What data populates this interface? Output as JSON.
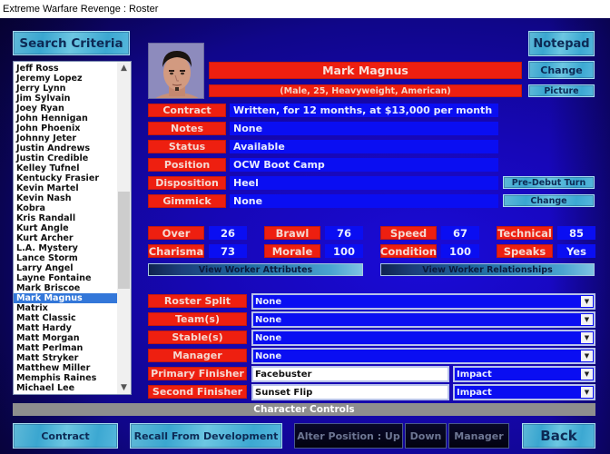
{
  "window": {
    "title": "Extreme Warfare Revenge : Roster"
  },
  "left": {
    "search_label": "Search Criteria",
    "roster": [
      "Jeff Ross",
      "Jeremy Lopez",
      "Jerry Lynn",
      "Jim Sylvain",
      "Joey Ryan",
      "John Hennigan",
      "John Phoenix",
      "Johnny Jeter",
      "Justin Andrews",
      "Justin Credible",
      "Kelley Tufnel",
      "Kentucky Frasier",
      "Kevin Martel",
      "Kevin Nash",
      "Kobra",
      "Kris Randall",
      "Kurt Angle",
      "Kurt Archer",
      "L.A. Mystery",
      "Lance Storm",
      "Larry Angel",
      "Layne Fontaine",
      "Mark Briscoe",
      "Mark Magnus",
      "Matrix",
      "Matt Classic",
      "Matt Hardy",
      "Matt Morgan",
      "Matt Perlman",
      "Matt Stryker",
      "Matthew Miller",
      "Memphis Raines",
      "Michael Lee"
    ],
    "selected": "Mark Magnus",
    "scroll_up_icon": "▲",
    "scroll_down_icon": "▼"
  },
  "worker": {
    "name": "Mark Magnus",
    "details": "(Male, 25, Heavyweight, American)",
    "photo_icon": "worker-portrait"
  },
  "right_buttons": {
    "notepad": "Notepad",
    "change_picture_line1": "Change",
    "change_picture_line2": "Picture",
    "pre_debut_turn": "Pre-Debut Turn",
    "change_gimmick": "Change"
  },
  "info_rows": [
    {
      "label": "Contract",
      "value": "Written, for 12 months, at $13,000 per month"
    },
    {
      "label": "Notes",
      "value": "None"
    },
    {
      "label": "Status",
      "value": "Available"
    },
    {
      "label": "Position",
      "value": "OCW Boot Camp"
    },
    {
      "label": "Disposition",
      "value": "Heel"
    },
    {
      "label": "Gimmick",
      "value": "None"
    }
  ],
  "stats": [
    {
      "label": "Over",
      "value": "26"
    },
    {
      "label": "Brawl",
      "value": "76"
    },
    {
      "label": "Speed",
      "value": "67"
    },
    {
      "label": "Technical",
      "value": "85"
    },
    {
      "label": "Charisma",
      "value": "73"
    },
    {
      "label": "Morale",
      "value": "100"
    },
    {
      "label": "Condition",
      "value": "100"
    },
    {
      "label": "Speaks",
      "value": "Yes"
    }
  ],
  "view_buttons": {
    "attributes": "View Worker Attributes",
    "relationships": "View Worker Relationships"
  },
  "assignments": [
    {
      "label": "Roster Split",
      "value": "None"
    },
    {
      "label": "Team(s)",
      "value": "None"
    },
    {
      "label": "Stable(s)",
      "value": "None"
    },
    {
      "label": "Manager",
      "value": "None"
    }
  ],
  "finishers": [
    {
      "label": "Primary Finisher",
      "name": "Facebuster",
      "type": "Impact"
    },
    {
      "label": "Second Finisher",
      "name": "Sunset Flip",
      "type": "Impact"
    }
  ],
  "dropdown_icon": "▼",
  "controls": {
    "section_title": "Character Controls",
    "contract": "Contract",
    "recall": "Recall From Development",
    "alter_up": "Alter Position : Up",
    "down": "Down",
    "manager": "Manager",
    "back": "Back"
  },
  "colors": {
    "label_red": "#ee1f10",
    "value_blue": "#0a0ef2",
    "selection_blue": "#3377d9",
    "aqua": "#3aa6d0"
  }
}
